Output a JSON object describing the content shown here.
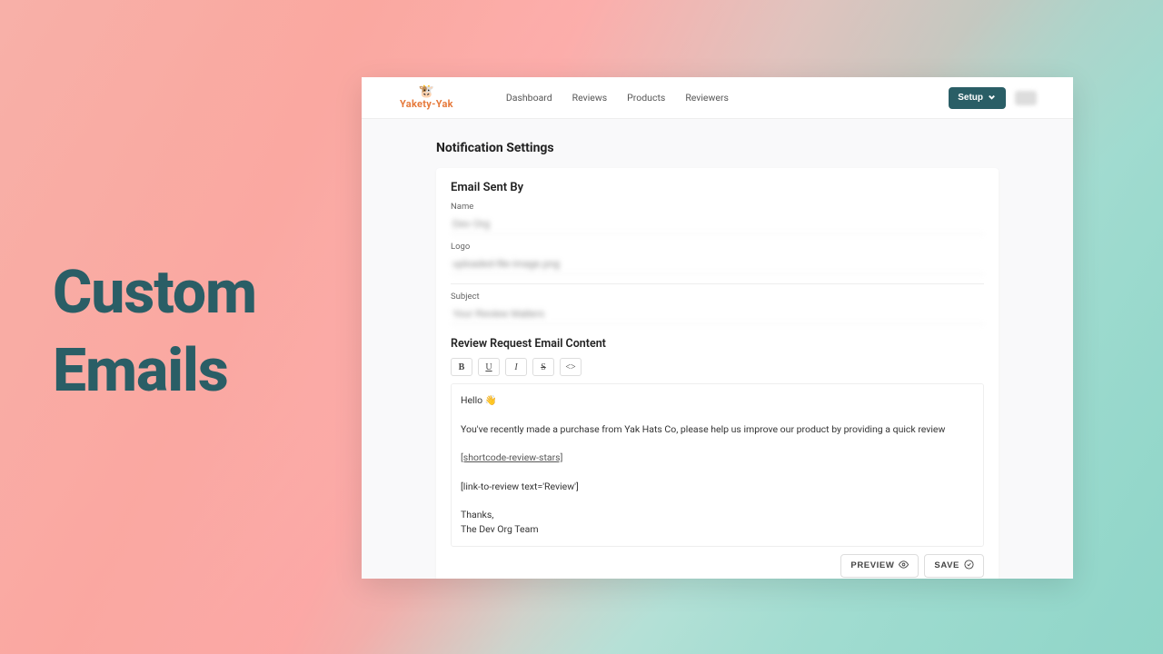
{
  "hero": {
    "line1": "Custom",
    "line2": "Emails"
  },
  "brand": {
    "name": "Yakety-Yak",
    "icon": "🐮"
  },
  "nav": {
    "dashboard": "Dashboard",
    "reviews": "Reviews",
    "products": "Products",
    "reviewers": "Reviewers"
  },
  "setup_label": "Setup",
  "page_title": "Notification Settings",
  "sent_by": {
    "heading": "Email Sent By",
    "name_label": "Name",
    "name_value": "Dev Org",
    "logo_label": "Logo",
    "logo_value": "uploaded-file-image.png"
  },
  "subject": {
    "label": "Subject",
    "value": "Your Review Matters"
  },
  "content_section": {
    "heading": "Review Request Email Content",
    "toolbar": {
      "bold": "B",
      "underline": "U",
      "italic": "I",
      "strike": "S",
      "code": "<>"
    },
    "body": {
      "greeting": "Hello 👋",
      "line1": "You've recently made a purchase from Yak Hats Co, please help us improve our product by providing a quick review",
      "shortcode": "[shortcode-review-stars]",
      "link": "[link-to-review text='Review']",
      "thanks": "Thanks,",
      "signoff": "The Dev Org Team"
    }
  },
  "actions": {
    "preview": "PREVIEW",
    "save": "SAVE"
  }
}
